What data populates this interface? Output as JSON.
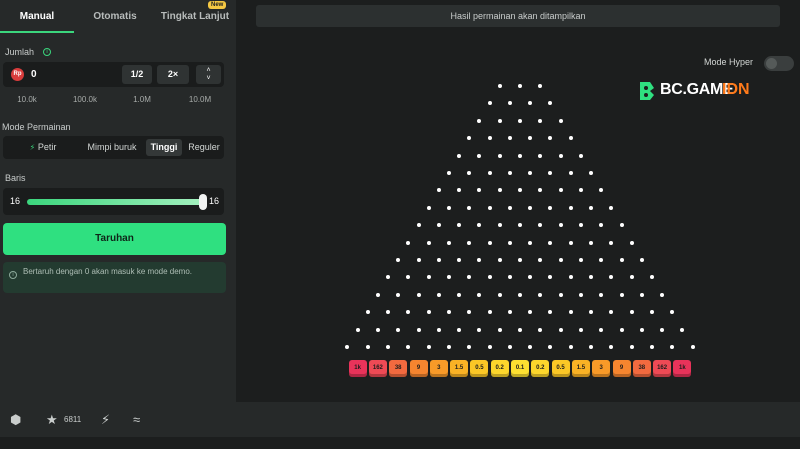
{
  "tabs": [
    "Manual",
    "Otomatis",
    "Tingkat Lanjut"
  ],
  "tab_badge": "New",
  "amount": {
    "label": "Jumlah",
    "currency_icon": "Rp",
    "value": "0",
    "half": "1/2",
    "double": "2×"
  },
  "quick_amounts": [
    "10.0k",
    "100.0k",
    "1.0M",
    "10.0M"
  ],
  "mode": {
    "label": "Mode Permainan",
    "options": [
      "Petir",
      "Mimpi buruk",
      "Tinggi",
      "Reguler"
    ],
    "selected": "Tinggi"
  },
  "rows": {
    "label": "Baris",
    "min": "16",
    "max": "16",
    "value": 16,
    "fraction": 1.0
  },
  "bet_button": "Taruhan",
  "notice": "Bertaruh dengan 0 akan masuk ke mode demo.",
  "game": {
    "result_text": "Hasil permainan akan ditampilkan",
    "hyper_label": "Mode Hyper",
    "hyper_on": false,
    "brand": "BC.GAME",
    "brand_suffix": "IDN",
    "peg_rows": 16,
    "multipliers": [
      "1k",
      "162",
      "38",
      "9",
      "3",
      "1.5",
      "0.5",
      "0.2",
      "0.1",
      "0.2",
      "0.5",
      "1.5",
      "3",
      "9",
      "38",
      "162",
      "1k"
    ],
    "multiplier_colors": [
      "#e8335a",
      "#ee4a55",
      "#f26a3f",
      "#f5852f",
      "#f89a28",
      "#f9b225",
      "#fbc726",
      "#fcd62c",
      "#fde031",
      "#fcd62c",
      "#fbc726",
      "#f9b225",
      "#f89a28",
      "#f5852f",
      "#f26a3f",
      "#ee4a55",
      "#e8335a"
    ]
  },
  "bottom": {
    "favorites_count": "6811",
    "icons": [
      "settings-icon",
      "star-icon",
      "lightning-icon",
      "fairness-icon"
    ]
  },
  "accent": "#2fe080"
}
